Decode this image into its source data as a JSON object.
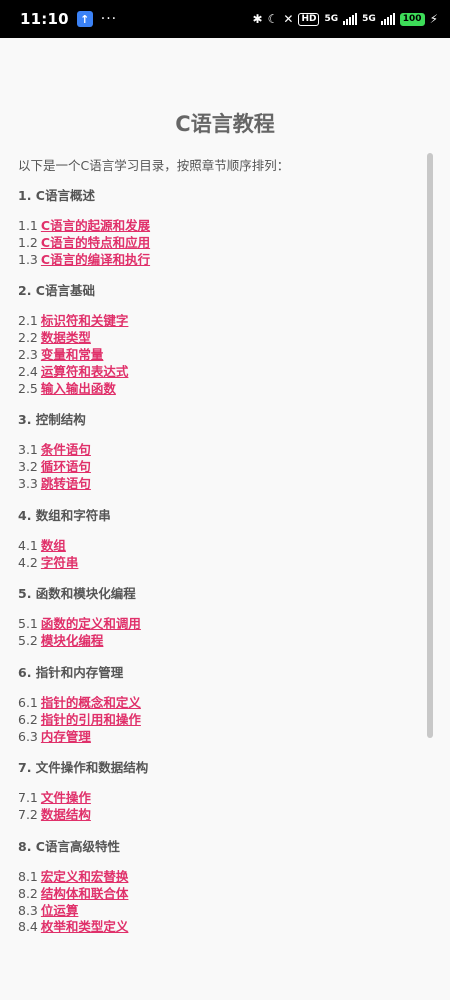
{
  "status": {
    "time": "11:10",
    "dots": "···",
    "signal1": "5G",
    "signal2": "5G",
    "hd": "HD",
    "battery": "100"
  },
  "page": {
    "title": "C语言教程",
    "intro": "以下是一个C语言学习目录，按照章节顺序排列："
  },
  "chapters": [
    {
      "title": "1.  C语言概述",
      "items": [
        {
          "num": "1.1",
          "label": "C语言的起源和发展"
        },
        {
          "num": "1.2",
          "label": "C语言的特点和应用"
        },
        {
          "num": "1.3",
          "label": "C语言的编译和执行"
        }
      ]
    },
    {
      "title": "2.  C语言基础",
      "items": [
        {
          "num": "2.1",
          "label": "标识符和关键字"
        },
        {
          "num": "2.2",
          "label": "数据类型"
        },
        {
          "num": "2.3",
          "label": "变量和常量"
        },
        {
          "num": "2.4",
          "label": "运算符和表达式"
        },
        {
          "num": "2.5",
          "label": "输入输出函数"
        }
      ]
    },
    {
      "title": "3.  控制结构",
      "items": [
        {
          "num": "3.1",
          "label": "条件语句"
        },
        {
          "num": "3.2",
          "label": "循环语句"
        },
        {
          "num": "3.3",
          "label": "跳转语句"
        }
      ]
    },
    {
      "title": "4.  数组和字符串",
      "items": [
        {
          "num": "4.1",
          "label": "数组"
        },
        {
          "num": "4.2",
          "label": "字符串"
        }
      ]
    },
    {
      "title": "5.  函数和模块化编程",
      "items": [
        {
          "num": "5.1",
          "label": "函数的定义和调用"
        },
        {
          "num": "5.2",
          "label": "模块化编程"
        }
      ]
    },
    {
      "title": "6.  指针和内存管理",
      "items": [
        {
          "num": "6.1",
          "label": "指针的概念和定义"
        },
        {
          "num": "6.2",
          "label": "指针的引用和操作"
        },
        {
          "num": "6.3",
          "label": "内存管理"
        }
      ]
    },
    {
      "title": "7.  文件操作和数据结构",
      "items": [
        {
          "num": "7.1",
          "label": "文件操作"
        },
        {
          "num": "7.2",
          "label": "数据结构"
        }
      ]
    },
    {
      "title": "8.  C语言高级特性",
      "items": [
        {
          "num": "8.1",
          "label": "宏定义和宏替换"
        },
        {
          "num": "8.2",
          "label": "结构体和联合体"
        },
        {
          "num": "8.3",
          "label": "位运算"
        },
        {
          "num": "8.4",
          "label": "枚举和类型定义"
        }
      ]
    }
  ]
}
